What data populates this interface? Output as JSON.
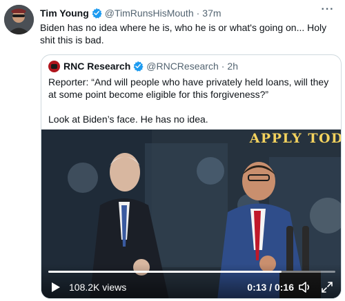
{
  "tweet": {
    "author_name": "Tim Young",
    "handle": "@TimRunsHisMouth",
    "separator": "·",
    "time": "37m",
    "more_icon": "···",
    "text": "Biden has no idea where he is, who he is or what's going on... Holy shit this is bad."
  },
  "quoted": {
    "author_name": "RNC Research",
    "handle": "@RNCResearch",
    "separator": "·",
    "time": "2h",
    "paragraph1": "Reporter: “And will people who have privately held loans, will they at some point become eligible for this forgiveness?”",
    "paragraph2": "Look at Biden’s face. He has no idea.",
    "video": {
      "banner_text": "APPLY TOD",
      "views": "108.2K views",
      "time_readout": "0:13 / 0:16",
      "progress_fraction": 0.8125
    }
  },
  "colors": {
    "verified_blue": "#1d9bf0",
    "banner_yellow": "#f4d35e",
    "rnc_red": "#b0151d"
  },
  "icons": [
    "verified-badge-icon",
    "more-icon",
    "play-icon",
    "volume-icon",
    "fullscreen-icon"
  ]
}
